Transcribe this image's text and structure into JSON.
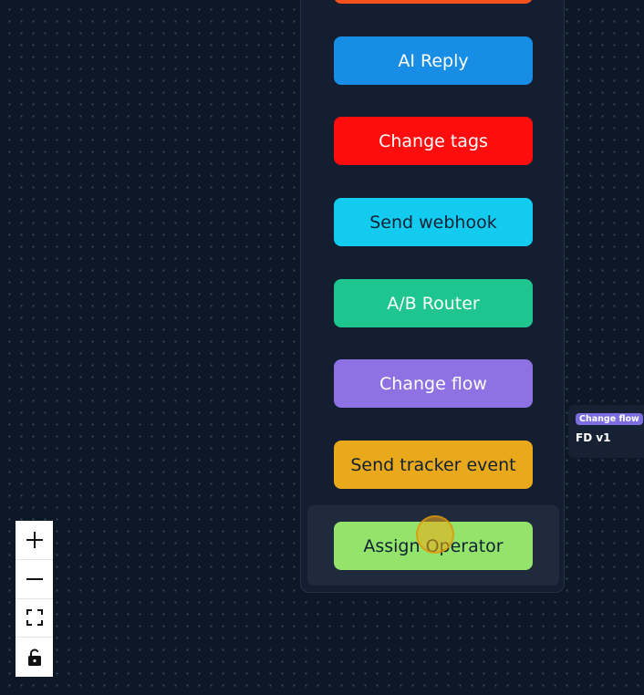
{
  "panel": {
    "buttons": [
      {
        "label": "AI Reply",
        "bg": "#178de6",
        "color": "#ffffff"
      },
      {
        "label": "Change tags",
        "bg": "#fd0d0d",
        "color": "#ffffff"
      },
      {
        "label": "Send webhook",
        "bg": "#12cbef",
        "color": "#0f2133"
      },
      {
        "label": "A/B Router",
        "bg": "#1ec58e",
        "color": "#ffffff"
      },
      {
        "label": "Change flow",
        "bg": "#8e72e3",
        "color": "#ffffff"
      },
      {
        "label": "Send tracker event",
        "bg": "#e9a91a",
        "color": "#0f2133"
      },
      {
        "label": "Assign Operator",
        "bg": "#94e36a",
        "color": "#0f2133"
      }
    ]
  },
  "node": {
    "badge": "Change flow",
    "title": "FD v1"
  },
  "zoom_controls": {
    "items": [
      "plus-icon",
      "minus-icon",
      "fit-view-icon",
      "unlock-icon"
    ]
  }
}
